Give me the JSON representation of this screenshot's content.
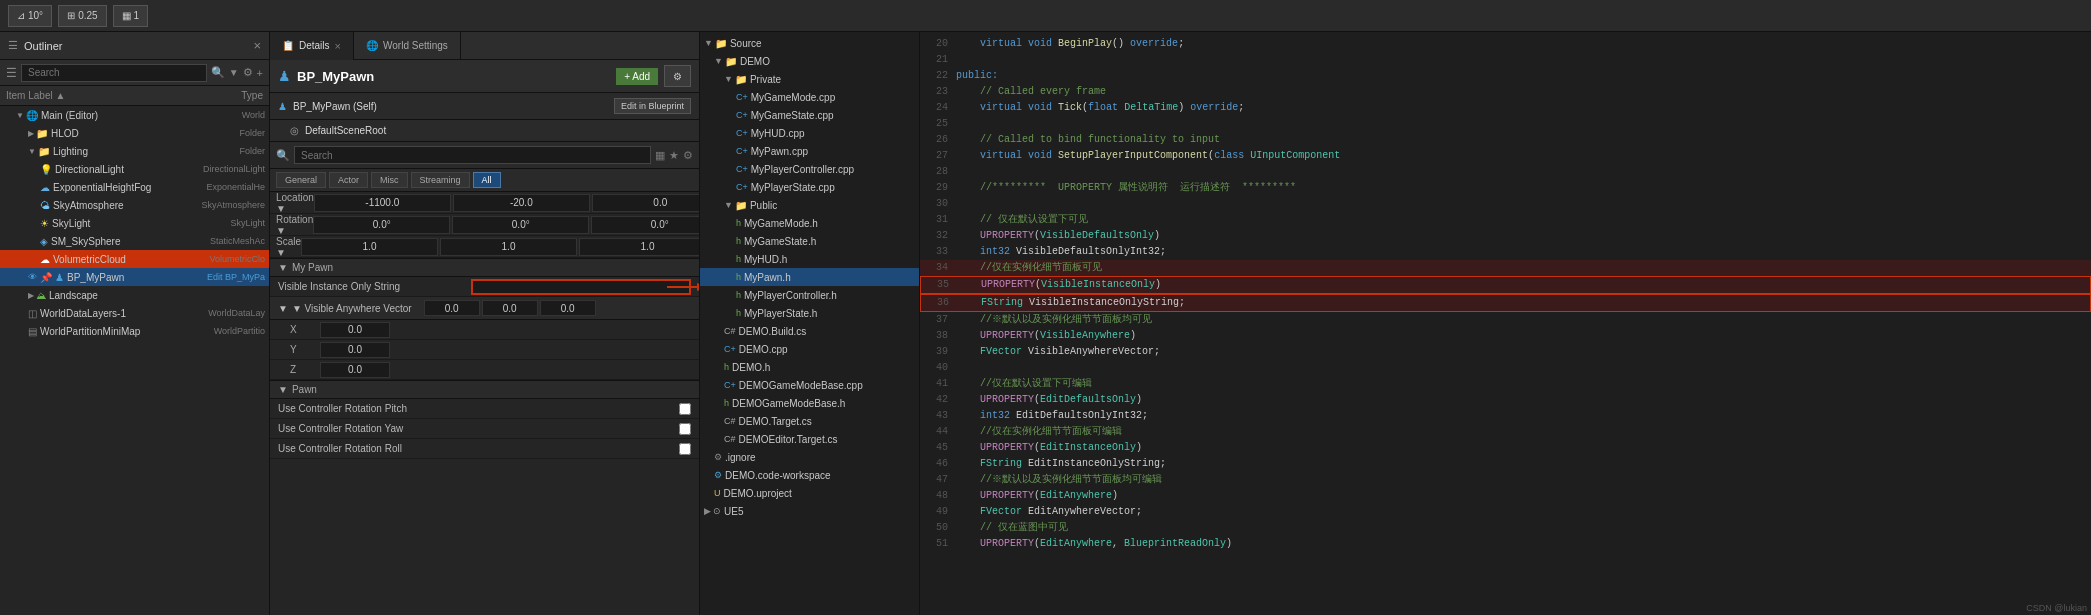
{
  "toolbar": {
    "angle_label": "10°",
    "scale_label": "0.25",
    "grid_label": "1"
  },
  "outliner": {
    "title": "Outliner",
    "search_placeholder": "Search",
    "col_label": "Item Label ▲",
    "col_type": "Type",
    "items": [
      {
        "id": "main-editor",
        "label": "Main (Editor)",
        "type": "World",
        "indent": 1,
        "arrow": "▼",
        "icon": "world"
      },
      {
        "id": "hlod",
        "label": "HLOD",
        "type": "Folder",
        "indent": 2,
        "arrow": "▶",
        "icon": "folder"
      },
      {
        "id": "lighting",
        "label": "Lighting",
        "type": "Folder",
        "indent": 2,
        "arrow": "▼",
        "icon": "folder"
      },
      {
        "id": "directionallight",
        "label": "DirectionalLight",
        "type": "DirectionalLight",
        "indent": 3,
        "icon": "light"
      },
      {
        "id": "exponentialheightfog",
        "label": "ExponentialHeightFog",
        "type": "ExponentialHe",
        "indent": 3,
        "icon": "fog"
      },
      {
        "id": "skyatmosphere",
        "label": "SkyAtmosphere",
        "type": "SkyAtmosphere",
        "indent": 3,
        "icon": "sky"
      },
      {
        "id": "skylight",
        "label": "SkyLight",
        "type": "SkyLight",
        "indent": 3,
        "icon": "skylight"
      },
      {
        "id": "sm_skysphere",
        "label": "SM_SkySphere",
        "type": "StaticMeshAc",
        "indent": 3,
        "icon": "mesh"
      },
      {
        "id": "volumetriccloud",
        "label": "VolumetricCloud",
        "type": "VolumetricClo",
        "indent": 3,
        "icon": "cloud",
        "highlighted": true
      },
      {
        "id": "bp_mypawn",
        "label": "BP_MyPawn",
        "type": "Edit BP_MyPa",
        "indent": 2,
        "icon": "pawn",
        "selected": true,
        "eye": true
      },
      {
        "id": "landscape",
        "label": "Landscape",
        "type": "",
        "indent": 2,
        "arrow": "▶",
        "icon": "landscape"
      },
      {
        "id": "worlddatalayers",
        "label": "WorldDataLayers-1",
        "type": "WorldDataLay",
        "indent": 2,
        "icon": "data"
      },
      {
        "id": "worldpartitionminimap",
        "label": "WorldPartitionMiniMap",
        "type": "WorldPartitio",
        "indent": 2,
        "icon": "minimap"
      }
    ]
  },
  "details": {
    "tab_label": "Details",
    "close_label": "×",
    "world_settings_tab": "World Settings",
    "actor_name": "BP_MyPawn",
    "self_label": "BP_MyPawn (Self)",
    "root_label": "DefaultSceneRoot",
    "edit_blueprint_label": "Edit in Blueprint",
    "add_label": "+ Add",
    "search_placeholder": "Search",
    "filter_tabs": [
      "General",
      "Actor",
      "Misc",
      "Streaming",
      "All"
    ],
    "active_filter": "All",
    "transform": {
      "location_label": "Location ▼",
      "x_val": "-1100.0",
      "y_val": "-20.0",
      "z_val": "0.0",
      "rotation_label": "Rotation ▼",
      "rx_val": "0.0°",
      "ry_val": "0.0°",
      "rz_val": "0.0°",
      "scale_label": "Scale ▼",
      "sx_val": "1.0",
      "sy_val": "1.0",
      "sz_val": "1.0"
    },
    "properties": {
      "visible_instance_only_string_label": "Visible Instance Only String",
      "visible_instance_only_string_val": "",
      "visible_anywhere_vector_label": "▼ Visible Anywhere Vector",
      "va_x_val": "0.0",
      "va_y_val": "0.0",
      "va_z_val": "0.0",
      "va_x_label": "X",
      "va_y_label": "Y",
      "va_z_label": "Z",
      "pawn_section_label": "▼ Pawn",
      "use_controller_rotation_pitch_label": "Use Controller Rotation Pitch",
      "use_controller_rotation_yaw_label": "Use Controller Rotation Yaw",
      "use_controller_rotation_roll_label": "Use Controller Rotation Roll"
    }
  },
  "filetree": {
    "items": [
      {
        "label": "Source",
        "indent": 0,
        "arrow": "▼",
        "icon": "folder"
      },
      {
        "label": "DEMO",
        "indent": 1,
        "arrow": "▼",
        "icon": "folder"
      },
      {
        "label": "Private",
        "indent": 2,
        "arrow": "▼",
        "icon": "folder"
      },
      {
        "label": "MyGameMode.cpp",
        "indent": 3,
        "icon": "cpp"
      },
      {
        "label": "MyGameState.cpp",
        "indent": 3,
        "icon": "cpp"
      },
      {
        "label": "MyHUD.cpp",
        "indent": 3,
        "icon": "cpp"
      },
      {
        "label": "MyPawn.cpp",
        "indent": 3,
        "icon": "cpp"
      },
      {
        "label": "MyPlayerController.cpp",
        "indent": 3,
        "icon": "cpp"
      },
      {
        "label": "MyPlayerState.cpp",
        "indent": 3,
        "icon": "cpp"
      },
      {
        "label": "Public",
        "indent": 2,
        "arrow": "▼",
        "icon": "folder"
      },
      {
        "label": "MyGameMode.h",
        "indent": 3,
        "icon": "h"
      },
      {
        "label": "MyGameState.h",
        "indent": 3,
        "icon": "h"
      },
      {
        "label": "MyHUD.h",
        "indent": 3,
        "icon": "h"
      },
      {
        "label": "MyPawn.h",
        "indent": 3,
        "icon": "h",
        "selected": true
      },
      {
        "label": "MyPlayerController.h",
        "indent": 3,
        "icon": "h"
      },
      {
        "label": "MyPlayerState.h",
        "indent": 3,
        "icon": "h"
      },
      {
        "label": "DEMO.Build.cs",
        "indent": 2,
        "icon": "cs"
      },
      {
        "label": "DEMO.cpp",
        "indent": 2,
        "icon": "cpp"
      },
      {
        "label": "DEMO.h",
        "indent": 2,
        "icon": "h"
      },
      {
        "label": "DEMOGameModeBase.cpp",
        "indent": 2,
        "icon": "cpp"
      },
      {
        "label": "DEMOGameModeBase.h",
        "indent": 2,
        "icon": "h"
      },
      {
        "label": "DEMO.Target.cs",
        "indent": 2,
        "icon": "cs"
      },
      {
        "label": "DEMOEditor.Target.cs",
        "indent": 2,
        "icon": "cs"
      },
      {
        "label": ".ignore",
        "indent": 1,
        "icon": "file"
      },
      {
        "label": "DEMO.code-workspace",
        "indent": 1,
        "icon": "workspace"
      },
      {
        "label": "DEMO.uproject",
        "indent": 1,
        "icon": "uproject"
      },
      {
        "label": "UE5",
        "indent": 0,
        "arrow": "▶",
        "icon": "folder"
      }
    ]
  },
  "code": {
    "lines": [
      {
        "num": 20,
        "text": "    virtual void BeginPlay() override;",
        "type": "normal"
      },
      {
        "num": 21,
        "text": "",
        "type": "normal"
      },
      {
        "num": 22,
        "text": "public:",
        "type": "keyword"
      },
      {
        "num": 23,
        "text": "    // Called every frame",
        "type": "comment"
      },
      {
        "num": 24,
        "text": "    virtual void Tick(float DeltaTime) override;",
        "type": "normal"
      },
      {
        "num": 25,
        "text": "",
        "type": "normal"
      },
      {
        "num": 26,
        "text": "    // Called to bind functionality to input",
        "type": "comment"
      },
      {
        "num": 27,
        "text": "    virtual void SetupPlayerInputComponent(class UInputComponent",
        "type": "normal"
      },
      {
        "num": 28,
        "text": "",
        "type": "normal"
      },
      {
        "num": 29,
        "text": "    //*********  UPROPERTY 属性说明符  运行描述符  *********",
        "type": "comment"
      },
      {
        "num": 30,
        "text": "",
        "type": "normal"
      },
      {
        "num": 31,
        "text": "    // 仅在默认设置下可见",
        "type": "comment"
      },
      {
        "num": 32,
        "text": "    UPROPERTY(VisibleDefaultsOnly)",
        "type": "macro"
      },
      {
        "num": 33,
        "text": "    int32 VisibleDefaultsOnlyInt32;",
        "type": "normal"
      },
      {
        "num": 34,
        "text": "    //仅在实例化细节面板可见",
        "type": "comment",
        "highlighted": true
      },
      {
        "num": 35,
        "text": "    UPROPERTY(VisibleInstanceOnly)",
        "type": "macro",
        "highlighted": true
      },
      {
        "num": 36,
        "text": "    FString VisibleInstanceOnlyString;",
        "type": "normal",
        "highlighted": true
      },
      {
        "num": 37,
        "text": "    //※默认以及实例化细节节面板均可见",
        "type": "comment"
      },
      {
        "num": 38,
        "text": "    UPROPERTY(VisibleAnywhere)",
        "type": "macro"
      },
      {
        "num": 39,
        "text": "    FVector VisibleAnywhereVector;",
        "type": "normal"
      },
      {
        "num": 40,
        "text": "",
        "type": "normal"
      },
      {
        "num": 41,
        "text": "    //仅在默认设置下可编辑",
        "type": "comment"
      },
      {
        "num": 42,
        "text": "    UPROPERTY(EditDefaultsOnly)",
        "type": "macro"
      },
      {
        "num": 43,
        "text": "    int32 EditDefaultsOnlyInt32;",
        "type": "normal"
      },
      {
        "num": 44,
        "text": "    //仅在实例化细节节面板可编辑",
        "type": "comment"
      },
      {
        "num": 45,
        "text": "    UPROPERTY(EditInstanceOnly)",
        "type": "macro"
      },
      {
        "num": 46,
        "text": "    FString EditInstanceOnlyString;",
        "type": "normal"
      },
      {
        "num": 47,
        "text": "    //※默认以及实例化细节节面板均可编辑",
        "type": "comment"
      },
      {
        "num": 48,
        "text": "    UPROPERTY(EditAnywhere)",
        "type": "macro"
      },
      {
        "num": 49,
        "text": "    FVector EditAnywhereVector;",
        "type": "normal"
      },
      {
        "num": 50,
        "text": "    // 仅在蓝图中可见",
        "type": "comment"
      },
      {
        "num": 51,
        "text": "    UPROPERTY(EditAnywhere, BlueprintReadOnly)",
        "type": "macro"
      }
    ],
    "watermark": "CSDN @lukian"
  }
}
